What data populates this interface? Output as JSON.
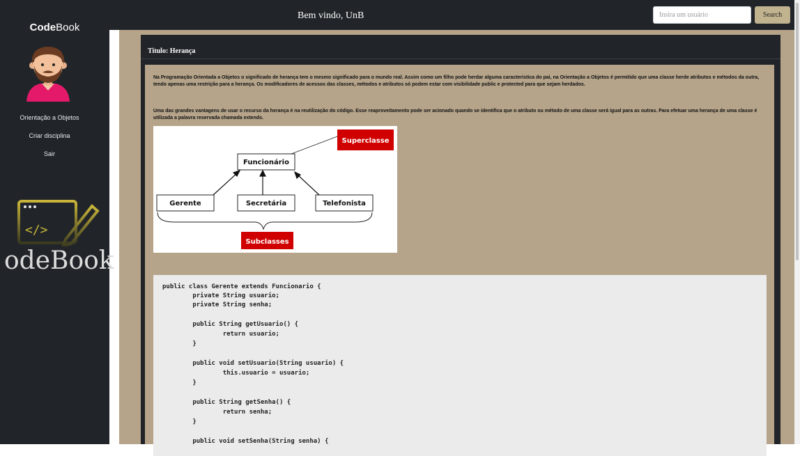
{
  "sidebar": {
    "brand_bold": "Code",
    "brand_rest": "Book",
    "items": [
      {
        "label": "Orientação a Objetos"
      },
      {
        "label": "Criar disciplina"
      },
      {
        "label": "Sair"
      }
    ],
    "logo_text": "odeBook"
  },
  "header": {
    "welcome": "Bem vindo, UnB",
    "search_placeholder": "Insira um usuário",
    "search_button": "Search"
  },
  "content": {
    "title": "Titulo: Herança",
    "paragraph1": "Na Programação Orientada a Objetos o significado de herança tem o mesmo significado para o mundo real. Assim como um filho pode herdar alguma característica do pai, na Orientação a Objetos é permitido que uma classe herde atributos e métodos da outra, tendo apenas uma restrição para a herança. Os modificadores de acessos das classes, métodos e atributos só podem estar com visibilidade public e protected para que sejam herdados.",
    "paragraph2": "Uma das grandes vantagens de usar o recurso da herança é na reutilização do código. Esse reaproveitamento pode ser acionado quando se identifica que o atributo ou método de uma classe será igual para as outras. Para efetuar uma herança de uma classe é utilizada a palavra reservada chamada extends.",
    "diagram": {
      "superclass_label": "Superclasse",
      "parent": "Funcionário",
      "children": [
        "Gerente",
        "Secretária",
        "Telefonista"
      ],
      "subclass_label": "Subclasses"
    },
    "code_lines": [
      "public class Gerente extends Funcionario {",
      "        private String usuario;",
      "        private String senha;",
      "",
      "        public String getUsuario() {",
      "                return usuario;",
      "        }",
      "",
      "        public void setUsuario(String usuario) {",
      "                this.usuario = usuario;",
      "        }",
      "",
      "        public String getSenha() {",
      "                return senha;",
      "        }",
      "",
      "        public void setSenha(String senha) {"
    ]
  },
  "colors": {
    "dark": "#212529",
    "tan": "#b5a48a",
    "red": "#d00000"
  }
}
